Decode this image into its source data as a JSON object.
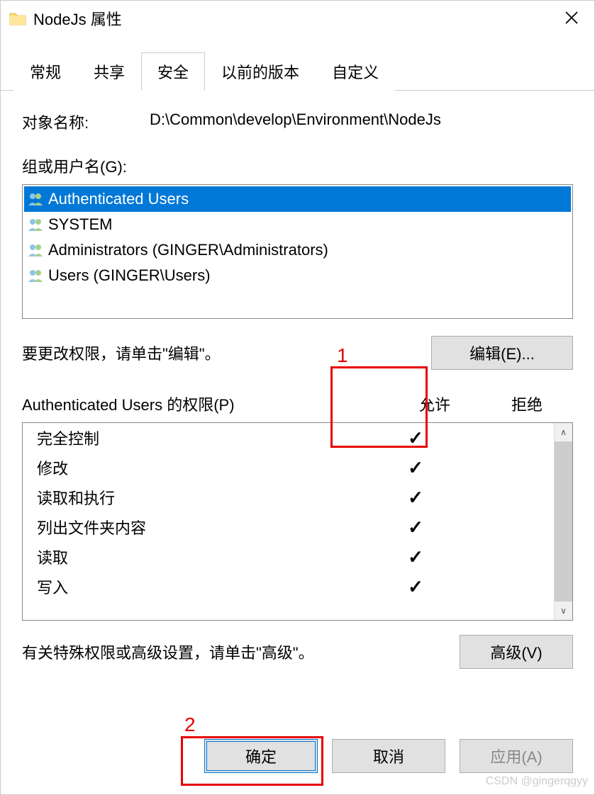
{
  "window": {
    "title": "NodeJs 属性"
  },
  "tabs": {
    "general": "常规",
    "sharing": "共享",
    "security": "安全",
    "previous": "以前的版本",
    "custom": "自定义"
  },
  "object": {
    "label": "对象名称:",
    "value": "D:\\Common\\develop\\Environment\\NodeJs"
  },
  "group_label": "组或用户名(G):",
  "users": [
    "Authenticated Users",
    "SYSTEM",
    "Administrators (GINGER\\Administrators)",
    "Users (GINGER\\Users)"
  ],
  "edit": {
    "hint": "要更改权限，请单击\"编辑\"。",
    "button": "编辑(E)..."
  },
  "perm_header": {
    "label": "Authenticated Users 的权限(P)",
    "allow": "允许",
    "deny": "拒绝"
  },
  "permissions": [
    {
      "name": "完全控制",
      "allow": true,
      "deny": false
    },
    {
      "name": "修改",
      "allow": true,
      "deny": false
    },
    {
      "name": "读取和执行",
      "allow": true,
      "deny": false
    },
    {
      "name": "列出文件夹内容",
      "allow": true,
      "deny": false
    },
    {
      "name": "读取",
      "allow": true,
      "deny": false
    },
    {
      "name": "写入",
      "allow": true,
      "deny": false
    }
  ],
  "advanced": {
    "hint": "有关特殊权限或高级设置，请单击\"高级\"。",
    "button": "高级(V)"
  },
  "footer": {
    "ok": "确定",
    "cancel": "取消",
    "apply": "应用(A)"
  },
  "annotations": {
    "label1": "1",
    "label2": "2"
  },
  "watermark": "CSDN @gingerqgyy"
}
